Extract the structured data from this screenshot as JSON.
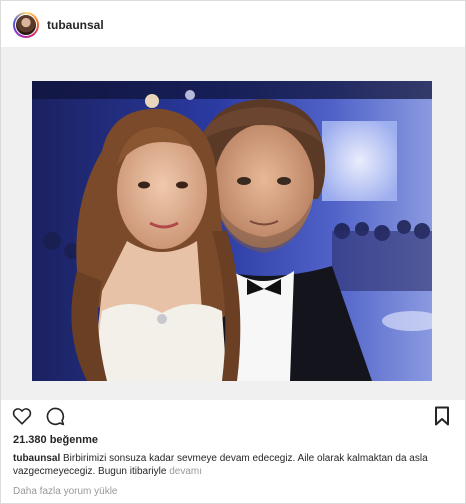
{
  "header": {
    "username": "tubaunsal"
  },
  "actions": {
    "like_icon": "heart-outline-icon",
    "comment_icon": "comment-bubble-icon",
    "save_icon": "bookmark-outline-icon"
  },
  "likes": {
    "text": "21.380 beğenme"
  },
  "caption": {
    "username": "tubaunsal",
    "text": "Birbirimizi sonsuza kadar sevmeye devam edecegiz. Aile olarak kalmaktan da asla vazgecmeyecegiz. Bugun itibariyle",
    "more_label": "devamı"
  },
  "comments": {
    "load_more_label": "Daha fazla yorum yükle"
  },
  "colors": {
    "text": "#262626",
    "muted": "#999999",
    "border": "#dbdbdb",
    "photo_matte": "#f0f0f0"
  }
}
